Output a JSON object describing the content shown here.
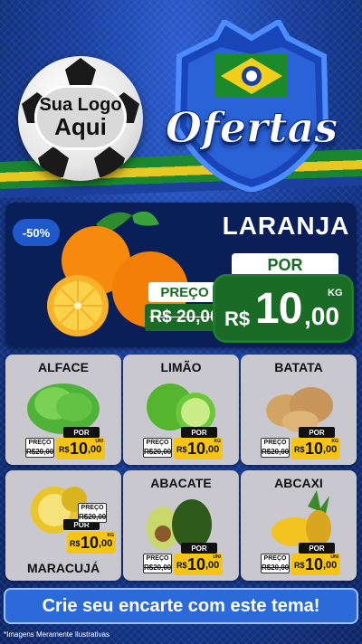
{
  "header": {
    "logo_line1": "Sua Logo",
    "logo_line2": "Aqui",
    "title": "Ofertas"
  },
  "hero": {
    "discount": "-50%",
    "name": "LARANJA",
    "por_label": "POR",
    "preco_label": "PREÇO",
    "old_price": "R$ 20,00",
    "currency": "R$",
    "price_int": "10",
    "price_dec": ",00",
    "unit": "KG"
  },
  "cards": [
    {
      "name": "ALFACE",
      "por": "POR",
      "preco": "PREÇO",
      "old": "R$20,00",
      "cur": "R$",
      "int": "10",
      "dec": ",00",
      "unit": "UNI"
    },
    {
      "name": "LIMÃO",
      "por": "POR",
      "preco": "PREÇO",
      "old": "R$20,00",
      "cur": "R$",
      "int": "10",
      "dec": ",00",
      "unit": "KG"
    },
    {
      "name": "BATATA",
      "por": "POR",
      "preco": "PREÇO",
      "old": "R$20,00",
      "cur": "R$",
      "int": "10",
      "dec": ",00",
      "unit": "KG"
    },
    {
      "name": "MARACUJÁ",
      "por": "POR",
      "preco": "PREÇO",
      "old": "R$20,00",
      "cur": "R$",
      "int": "10",
      "dec": ",00",
      "unit": "KG"
    },
    {
      "name": "ABACATE",
      "por": "POR",
      "preco": "PREÇO",
      "old": "R$20,00",
      "cur": "R$",
      "int": "10",
      "dec": ",00",
      "unit": "UNI"
    },
    {
      "name": "ABCAXI",
      "por": "POR",
      "preco": "PREÇO",
      "old": "R$20,00",
      "cur": "R$",
      "int": "10",
      "dec": ",00",
      "unit": "UNI"
    }
  ],
  "cta": "Crie seu encarte com este tema!",
  "footnote": "*Imagens Meramente Ilustrativas",
  "colors": {
    "accent_green": "#1a6b25",
    "price_yellow": "#f6c514",
    "brand_blue": "#1f58c9"
  }
}
